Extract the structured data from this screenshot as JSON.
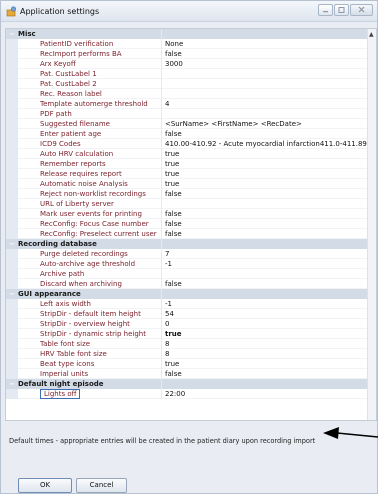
{
  "window": {
    "title": "Application settings",
    "icon": "app-settings-icon",
    "controls": [
      "minimize-icon",
      "maximize-icon",
      "close-icon"
    ]
  },
  "categories": [
    {
      "label": "Misc",
      "expanded": true,
      "properties": [
        {
          "name": "PatientID verification",
          "value": "None"
        },
        {
          "name": "RecImport performs BA",
          "value": "false"
        },
        {
          "name": "Arx Keyoff",
          "value": "3000"
        },
        {
          "name": "Pat. CustLabel 1",
          "value": ""
        },
        {
          "name": "Pat. CustLabel 2",
          "value": ""
        },
        {
          "name": "Rec. Reason label",
          "value": ""
        },
        {
          "name": "Template automerge threshold",
          "value": "4"
        },
        {
          "name": "PDF path",
          "value": ""
        },
        {
          "name": "Suggested filename",
          "value": "<SurName> <FirstName> <RecDate>"
        },
        {
          "name": "Enter patient age",
          "value": "false"
        },
        {
          "name": "ICD9 Codes",
          "value": "410.00-410.92 - Acute myocardial infarction411.0-411.89 - ..."
        },
        {
          "name": "Auto HRV calculation",
          "value": "true"
        },
        {
          "name": "Remember reports",
          "value": "true"
        },
        {
          "name": "Release requires report",
          "value": "true"
        },
        {
          "name": "Automatic noise Analysis",
          "value": "true"
        },
        {
          "name": "Reject non-worklist recordings",
          "value": "false"
        },
        {
          "name": "URL of Liberty server",
          "value": ""
        },
        {
          "name": "Mark user events for printing",
          "value": "false"
        },
        {
          "name": "RecConfig: Focus Case number",
          "value": "false"
        },
        {
          "name": "RecConfig: Preselect current user",
          "value": "false"
        }
      ]
    },
    {
      "label": "Recording database",
      "expanded": true,
      "properties": [
        {
          "name": "Purge deleted recordings",
          "value": "7"
        },
        {
          "name": "Auto-archive age threshold",
          "value": "-1"
        },
        {
          "name": "Archive path",
          "value": ""
        },
        {
          "name": "Discard when archiving",
          "value": "false"
        }
      ]
    },
    {
      "label": "GUI appearance",
      "expanded": true,
      "properties": [
        {
          "name": "Left axis width",
          "value": "-1"
        },
        {
          "name": "StripDir - default item height",
          "value": "54"
        },
        {
          "name": "StripDir - overview height",
          "value": "0"
        },
        {
          "name": "StripDir - dynamic strip height",
          "value": "true",
          "bold": true
        },
        {
          "name": "Table font size",
          "value": "8"
        },
        {
          "name": "HRV Table font size",
          "value": "8"
        },
        {
          "name": "Beat type icons",
          "value": "true"
        },
        {
          "name": "Imperial units",
          "value": "false"
        }
      ]
    },
    {
      "label": "Default night episode",
      "expanded": true,
      "properties": [
        {
          "name": "Lights off",
          "value": "22:00",
          "selected": true
        }
      ]
    }
  ],
  "description": "Default times - appropriate entries will be created in the patient diary upon recording import",
  "buttons": {
    "ok": "OK",
    "cancel": "Cancel"
  }
}
